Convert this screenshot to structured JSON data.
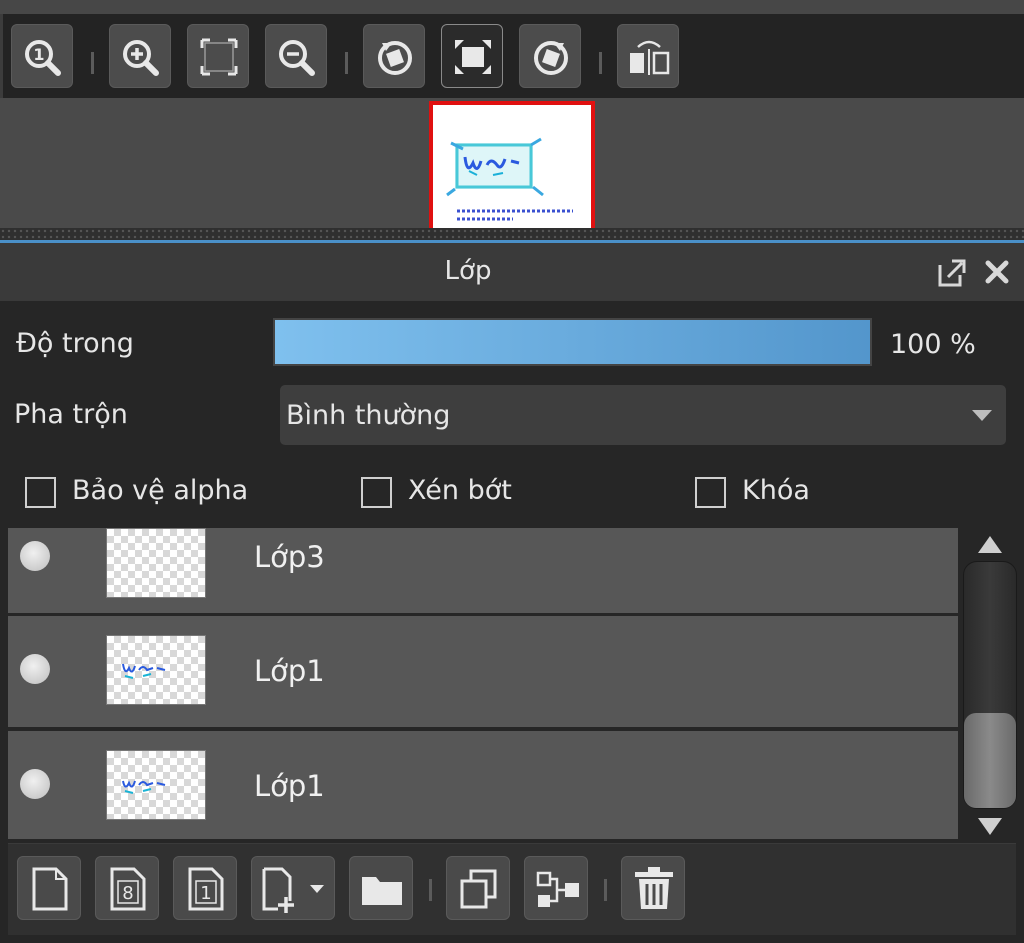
{
  "toolbar": {
    "buttons": [
      {
        "name": "zoom-actual-size",
        "icon": "magnifier-one-icon"
      },
      {
        "name": "zoom-in",
        "icon": "zoom-in-icon"
      },
      {
        "name": "fit-window",
        "icon": "fit-window-icon"
      },
      {
        "name": "zoom-out",
        "icon": "zoom-out-icon"
      },
      {
        "name": "rotate-left",
        "icon": "rotate-left-icon"
      },
      {
        "name": "reset-view",
        "icon": "fit-canvas-icon"
      },
      {
        "name": "rotate-right",
        "icon": "rotate-right-icon"
      },
      {
        "name": "flip-horizontal",
        "icon": "flip-horizontal-icon"
      }
    ],
    "active_button": "reset-view"
  },
  "navigator": {
    "frame_color": "#e01010"
  },
  "layers_panel": {
    "title": "Lớp",
    "opacity_label": "Độ trong",
    "opacity_value": 100,
    "opacity_text": "100 %",
    "blend_label": "Pha trộn",
    "blend_mode": "Bình thường",
    "checkboxes": [
      {
        "label": "Bảo vệ alpha",
        "checked": false
      },
      {
        "label": "Xén bớt",
        "checked": false
      },
      {
        "label": "Khóa",
        "checked": false
      }
    ],
    "layers": [
      {
        "name": "Lớp3",
        "visible": true,
        "has_content": false
      },
      {
        "name": "Lớp1",
        "visible": true,
        "has_content": true
      },
      {
        "name": "Lớp1",
        "visible": true,
        "has_content": true
      }
    ],
    "scroll_fraction": 1.0
  },
  "bottom_toolbar": {
    "buttons": [
      {
        "name": "new-layer",
        "icon": "new-page-icon"
      },
      {
        "name": "new-8bit-layer",
        "icon": "new-8bit-layer-icon",
        "glyph": "8"
      },
      {
        "name": "new-1bit-layer",
        "icon": "new-1bit-layer-icon",
        "glyph": "1"
      },
      {
        "name": "add-layer-menu",
        "icon": "add-layer-dropdown-icon"
      },
      {
        "name": "new-folder",
        "icon": "folder-icon"
      },
      {
        "name": "duplicate-layer",
        "icon": "duplicate-icon"
      },
      {
        "name": "merge-layer",
        "icon": "merge-down-icon"
      },
      {
        "name": "delete-layer",
        "icon": "trash-icon"
      }
    ]
  },
  "colors": {
    "accent": "#4a90c8",
    "panel_bg": "#262626",
    "layer_row_bg": "#575757"
  }
}
